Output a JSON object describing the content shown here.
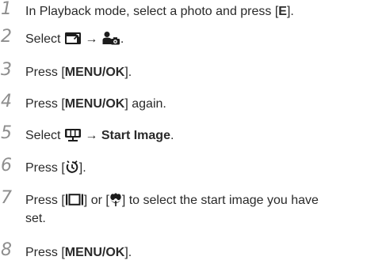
{
  "steps": [
    {
      "num": "1",
      "t1": "In Playback mode, select a photo and press [",
      "key": "E",
      "t2": "]."
    },
    {
      "num": "2",
      "t1": "Select ",
      "arrow": "→",
      "t2": ".",
      "icons": [
        "edit-frame-icon",
        "person-camera-icon"
      ]
    },
    {
      "num": "3",
      "t1": "Press [",
      "key": "MENU/OK",
      "t2": "]."
    },
    {
      "num": "4",
      "t1": "Press [",
      "key": "MENU/OK",
      "t2": "] again."
    },
    {
      "num": "5",
      "t1": "Select ",
      "arrow": "→ ",
      "bold": "Start Image",
      "t2": ".",
      "icons": [
        "slideshow-icon"
      ]
    },
    {
      "num": "6",
      "t1": "Press [",
      "t2": "].",
      "icons": [
        "self-timer-icon"
      ]
    },
    {
      "num": "7",
      "t1": "Press [",
      "mid": "] or [",
      "t2": "] to select the start image you have",
      "t3": "set.",
      "icons": [
        "display-icon",
        "macro-icon"
      ]
    },
    {
      "num": "8",
      "t1": "Press [",
      "key": "MENU/OK",
      "t2": "]."
    }
  ]
}
